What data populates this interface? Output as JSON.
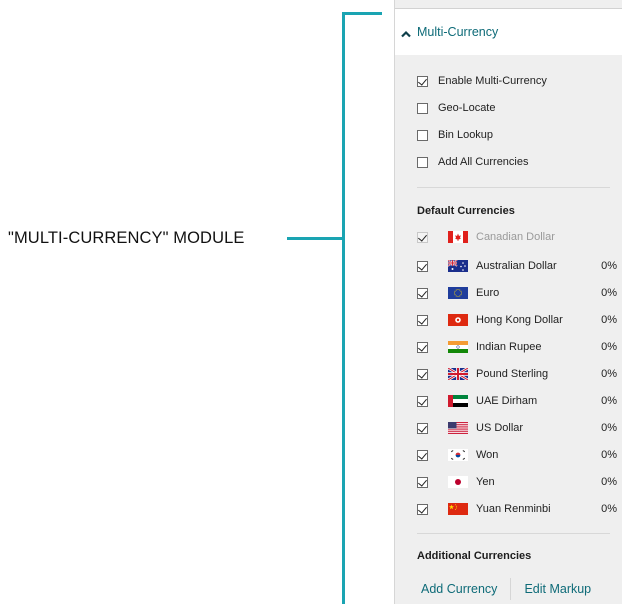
{
  "annotation": {
    "label": "\"MULTI-CURRENCY\" MODULE",
    "accent_color": "#1aa4b2"
  },
  "panel": {
    "header": {
      "title": "Multi-Currency",
      "icon": "chevron-up-icon",
      "expanded": true
    },
    "options": [
      {
        "label": "Enable Multi-Currency",
        "checked": true
      },
      {
        "label": "Geo-Locate",
        "checked": false
      },
      {
        "label": "Bin Lookup",
        "checked": false
      },
      {
        "label": "Add All Currencies",
        "checked": false
      }
    ],
    "default_currencies": {
      "heading": "Default Currencies",
      "items": [
        {
          "name": "Canadian Dollar",
          "flag": "canada-flag-icon",
          "checked": true,
          "disabled": true,
          "markup": ""
        },
        {
          "name": "Australian Dollar",
          "flag": "australia-flag-icon",
          "checked": true,
          "disabled": false,
          "markup": "0%"
        },
        {
          "name": "Euro",
          "flag": "eu-flag-icon",
          "checked": true,
          "disabled": false,
          "markup": "0%"
        },
        {
          "name": "Hong Kong Dollar",
          "flag": "hong-kong-flag-icon",
          "checked": true,
          "disabled": false,
          "markup": "0%"
        },
        {
          "name": "Indian Rupee",
          "flag": "india-flag-icon",
          "checked": true,
          "disabled": false,
          "markup": "0%"
        },
        {
          "name": "Pound Sterling",
          "flag": "uk-flag-icon",
          "checked": true,
          "disabled": false,
          "markup": "0%"
        },
        {
          "name": "UAE Dirham",
          "flag": "uae-flag-icon",
          "checked": true,
          "disabled": false,
          "markup": "0%"
        },
        {
          "name": "US Dollar",
          "flag": "us-flag-icon",
          "checked": true,
          "disabled": false,
          "markup": "0%"
        },
        {
          "name": "Won",
          "flag": "korea-flag-icon",
          "checked": true,
          "disabled": false,
          "markup": "0%"
        },
        {
          "name": "Yen",
          "flag": "japan-flag-icon",
          "checked": true,
          "disabled": false,
          "markup": "0%"
        },
        {
          "name": "Yuan Renminbi",
          "flag": "china-flag-icon",
          "checked": true,
          "disabled": false,
          "markup": "0%"
        }
      ]
    },
    "additional_currencies": {
      "heading": "Additional Currencies"
    },
    "buttons": {
      "add_currency": "Add Currency",
      "edit_markup": "Edit Markup"
    },
    "link_color": "#0e6b78"
  }
}
